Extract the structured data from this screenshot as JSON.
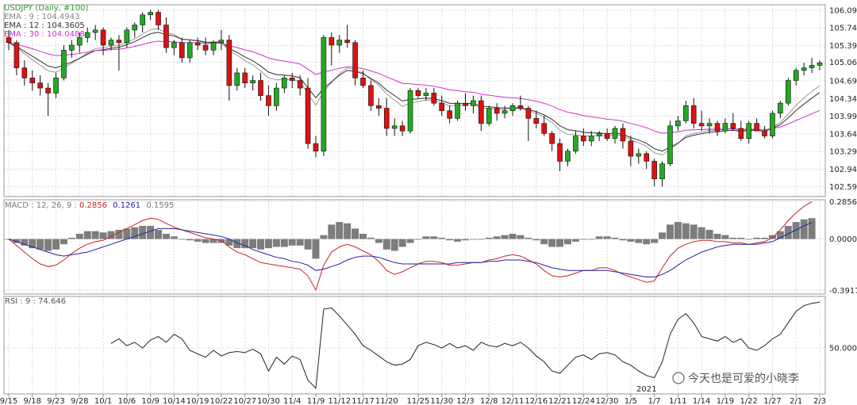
{
  "chart_data": [
    {
      "type": "candlestick",
      "title": "USDJPY (Daily, #100)",
      "ylim": [
        102.4,
        106.2
      ],
      "y_ticks": [
        "106.093",
        "105.743",
        "105.393",
        "105.065",
        "104.693",
        "104.343",
        "103.993",
        "103.643",
        "103.293",
        "102.943",
        "102.593"
      ],
      "ema_labels": [
        {
          "text": "EMA : 9 : 104.4943",
          "color": "#888888"
        },
        {
          "text": "EMA : 12 : 104.3605",
          "color": "#333333"
        },
        {
          "text": "EMA : 30 : 104.0488",
          "color": "#cc33cc"
        }
      ],
      "x_labels": [
        "9/15",
        "9/18",
        "9/23",
        "9/28",
        "10/1",
        "10/6",
        "10/9",
        "10/14",
        "10/19",
        "10/22",
        "10/27",
        "10/30",
        "11/4",
        "11/9",
        "11/12",
        "11/17",
        "11/20",
        "11/25",
        "11/30",
        "12/3",
        "12/8",
        "12/11",
        "12/16",
        "12/21",
        "12/24",
        "12/30",
        "1/5",
        "1/7",
        "1/11",
        "1/14",
        "1/19",
        "1/22",
        "1/27",
        "2/1",
        "2/3"
      ],
      "year_label": "2021",
      "up_color": "#22aa22",
      "down_color": "#dd1111",
      "candles": [
        [
          105.55,
          105.7,
          105.3,
          105.45
        ],
        [
          105.45,
          105.5,
          104.8,
          104.95
        ],
        [
          104.95,
          105.1,
          104.6,
          104.75
        ],
        [
          104.75,
          104.9,
          104.5,
          104.65
        ],
        [
          104.65,
          104.8,
          104.4,
          104.55
        ],
        [
          104.55,
          104.65,
          104.0,
          104.45
        ],
        [
          104.45,
          104.85,
          104.35,
          104.75
        ],
        [
          104.75,
          105.4,
          104.7,
          105.3
        ],
        [
          105.3,
          105.5,
          105.15,
          105.4
        ],
        [
          105.4,
          105.65,
          105.25,
          105.55
        ],
        [
          105.55,
          105.75,
          105.45,
          105.65
        ],
        [
          105.65,
          105.8,
          105.5,
          105.7
        ],
        [
          105.7,
          105.75,
          105.2,
          105.4
        ],
        [
          105.4,
          105.55,
          105.3,
          105.5
        ],
        [
          105.5,
          105.6,
          104.9,
          105.45
        ],
        [
          105.45,
          105.75,
          105.35,
          105.7
        ],
        [
          105.7,
          105.85,
          105.55,
          105.8
        ],
        [
          105.8,
          106.05,
          105.65,
          106.0
        ],
        [
          106.0,
          106.1,
          105.9,
          106.05
        ],
        [
          106.05,
          106.1,
          105.7,
          105.8
        ],
        [
          105.8,
          105.95,
          105.25,
          105.35
        ],
        [
          105.35,
          105.5,
          105.2,
          105.45
        ],
        [
          105.45,
          105.55,
          105.05,
          105.15
        ],
        [
          105.15,
          105.5,
          105.05,
          105.45
        ],
        [
          105.45,
          105.55,
          105.3,
          105.4
        ],
        [
          105.4,
          105.55,
          105.2,
          105.3
        ],
        [
          105.3,
          105.5,
          105.2,
          105.45
        ],
        [
          105.45,
          105.7,
          105.3,
          105.5
        ],
        [
          105.5,
          105.6,
          104.3,
          104.6
        ],
        [
          104.6,
          104.95,
          104.5,
          104.85
        ],
        [
          104.85,
          104.95,
          104.55,
          104.65
        ],
        [
          104.65,
          104.8,
          104.5,
          104.7
        ],
        [
          104.7,
          104.85,
          104.3,
          104.4
        ],
        [
          104.4,
          104.6,
          104.0,
          104.2
        ],
        [
          104.2,
          104.65,
          104.1,
          104.55
        ],
        [
          104.55,
          104.8,
          104.45,
          104.75
        ],
        [
          104.75,
          104.85,
          104.55,
          104.7
        ],
        [
          104.7,
          104.8,
          104.4,
          104.55
        ],
        [
          104.55,
          104.75,
          103.35,
          103.45
        ],
        [
          103.45,
          103.6,
          103.18,
          103.3
        ],
        [
          103.3,
          105.6,
          103.2,
          105.55
        ],
        [
          105.55,
          105.65,
          105.0,
          105.4
        ],
        [
          105.4,
          105.6,
          105.25,
          105.5
        ],
        [
          105.5,
          105.8,
          105.35,
          105.45
        ],
        [
          105.45,
          105.5,
          104.6,
          104.75
        ],
        [
          104.75,
          104.9,
          104.55,
          104.6
        ],
        [
          104.6,
          104.7,
          104.1,
          104.2
        ],
        [
          104.2,
          104.35,
          104.0,
          104.15
        ],
        [
          104.15,
          104.35,
          103.6,
          103.75
        ],
        [
          103.75,
          103.95,
          103.6,
          103.8
        ],
        [
          103.8,
          103.9,
          103.6,
          103.7
        ],
        [
          103.7,
          104.55,
          103.65,
          104.5
        ],
        [
          104.5,
          104.55,
          104.35,
          104.4
        ],
        [
          104.4,
          104.55,
          104.3,
          104.45
        ],
        [
          104.45,
          104.55,
          104.2,
          104.25
        ],
        [
          104.25,
          104.4,
          104.0,
          104.1
        ],
        [
          104.1,
          104.2,
          103.85,
          103.95
        ],
        [
          103.95,
          104.3,
          103.9,
          104.25
        ],
        [
          104.25,
          104.45,
          104.1,
          104.2
        ],
        [
          104.2,
          104.4,
          104.05,
          104.3
        ],
        [
          104.3,
          104.4,
          103.7,
          103.85
        ],
        [
          103.85,
          104.2,
          103.8,
          104.15
        ],
        [
          104.15,
          104.25,
          103.9,
          104.05
        ],
        [
          104.05,
          104.2,
          103.95,
          104.1
        ],
        [
          104.1,
          104.25,
          104.0,
          104.2
        ],
        [
          104.2,
          104.4,
          104.1,
          104.15
        ],
        [
          104.15,
          104.2,
          103.5,
          103.95
        ],
        [
          103.95,
          104.1,
          103.75,
          103.85
        ],
        [
          103.85,
          104.0,
          103.6,
          103.65
        ],
        [
          103.65,
          103.7,
          103.3,
          103.45
        ],
        [
          103.45,
          103.55,
          102.9,
          103.1
        ],
        [
          103.1,
          103.35,
          103.0,
          103.3
        ],
        [
          103.3,
          103.7,
          103.25,
          103.6
        ],
        [
          103.6,
          103.75,
          103.4,
          103.5
        ],
        [
          103.5,
          103.7,
          103.4,
          103.6
        ],
        [
          103.6,
          103.7,
          103.5,
          103.65
        ],
        [
          103.65,
          103.75,
          103.5,
          103.55
        ],
        [
          103.55,
          103.8,
          103.45,
          103.75
        ],
        [
          103.75,
          103.85,
          103.35,
          103.5
        ],
        [
          103.5,
          103.6,
          103.0,
          103.2
        ],
        [
          103.2,
          103.35,
          103.05,
          103.25
        ],
        [
          103.25,
          103.3,
          102.95,
          103.1
        ],
        [
          103.1,
          103.15,
          102.6,
          102.75
        ],
        [
          102.75,
          103.1,
          102.6,
          103.05
        ],
        [
          103.05,
          103.9,
          103.0,
          103.8
        ],
        [
          103.8,
          104.0,
          103.7,
          103.9
        ],
        [
          103.9,
          104.3,
          103.85,
          104.2
        ],
        [
          104.2,
          104.35,
          103.75,
          103.85
        ],
        [
          103.85,
          104.1,
          103.7,
          103.8
        ],
        [
          103.8,
          103.95,
          103.65,
          103.85
        ],
        [
          103.85,
          103.9,
          103.6,
          103.7
        ],
        [
          103.7,
          103.95,
          103.65,
          103.85
        ],
        [
          103.85,
          104.05,
          103.7,
          103.75
        ],
        [
          103.75,
          103.9,
          103.5,
          103.55
        ],
        [
          103.55,
          103.9,
          103.45,
          103.85
        ],
        [
          103.85,
          103.95,
          103.7,
          103.7
        ],
        [
          103.7,
          103.8,
          103.55,
          103.6
        ],
        [
          103.6,
          104.1,
          103.55,
          104.05
        ],
        [
          104.05,
          104.3,
          103.95,
          104.25
        ],
        [
          104.25,
          104.75,
          104.2,
          104.7
        ],
        [
          104.7,
          104.95,
          104.6,
          104.9
        ],
        [
          104.9,
          105.05,
          104.8,
          104.95
        ],
        [
          104.95,
          105.15,
          104.85,
          105.0
        ],
        [
          105.0,
          105.1,
          104.9,
          105.05
        ]
      ]
    },
    {
      "type": "line",
      "title": "MACD",
      "label_prefix": "MACD : 12, 26, 9 : ",
      "values_text": [
        "0.2856",
        "0.1261",
        "0.1595"
      ],
      "value_colors": [
        "#cc2222",
        "#2222aa",
        "#777777"
      ],
      "y_ticks": [
        "0.2856",
        "0.0000",
        "-0.3917"
      ],
      "ylim": [
        -0.42,
        0.3
      ],
      "series": [
        {
          "values": [
            -0.0,
            -0.05,
            -0.1,
            -0.15,
            -0.19,
            -0.21,
            -0.2,
            -0.16,
            -0.11,
            -0.07,
            -0.04,
            -0.02,
            -0.01,
            0.02,
            0.05,
            0.08,
            0.11,
            0.14,
            0.16,
            0.15,
            0.12,
            0.09,
            0.07,
            0.05,
            0.03,
            0.01,
            0.0,
            -0.01,
            -0.06,
            -0.1,
            -0.12,
            -0.15,
            -0.18,
            -0.19,
            -0.2,
            -0.21,
            -0.22,
            -0.23,
            -0.28,
            -0.39,
            -0.2,
            -0.1,
            -0.06,
            -0.04,
            -0.06,
            -0.09,
            -0.12,
            -0.17,
            -0.24,
            -0.27,
            -0.25,
            -0.22,
            -0.19,
            -0.17,
            -0.17,
            -0.18,
            -0.2,
            -0.2,
            -0.19,
            -0.18,
            -0.18,
            -0.16,
            -0.15,
            -0.13,
            -0.12,
            -0.13,
            -0.16,
            -0.19,
            -0.24,
            -0.28,
            -0.29,
            -0.28,
            -0.26,
            -0.24,
            -0.24,
            -0.22,
            -0.22,
            -0.24,
            -0.27,
            -0.29,
            -0.31,
            -0.33,
            -0.32,
            -0.22,
            -0.13,
            -0.07,
            -0.04,
            -0.02,
            -0.01,
            -0.01,
            -0.02,
            -0.02,
            -0.03,
            -0.03,
            -0.04,
            -0.03,
            -0.02,
            0.01,
            0.07,
            0.14,
            0.2,
            0.25,
            0.2856
          ]
        },
        {
          "values": [
            -0.0,
            -0.02,
            -0.04,
            -0.06,
            -0.08,
            -0.1,
            -0.12,
            -0.13,
            -0.12,
            -0.11,
            -0.1,
            -0.08,
            -0.06,
            -0.04,
            -0.02,
            0.0,
            0.02,
            0.04,
            0.06,
            0.08,
            0.08,
            0.08,
            0.07,
            0.06,
            0.05,
            0.04,
            0.03,
            0.02,
            -0.0,
            -0.03,
            -0.05,
            -0.08,
            -0.1,
            -0.12,
            -0.14,
            -0.15,
            -0.17,
            -0.18,
            -0.2,
            -0.24,
            -0.23,
            -0.21,
            -0.19,
            -0.16,
            -0.14,
            -0.13,
            -0.13,
            -0.14,
            -0.16,
            -0.18,
            -0.19,
            -0.19,
            -0.19,
            -0.19,
            -0.19,
            -0.19,
            -0.19,
            -0.18,
            -0.18,
            -0.18,
            -0.18,
            -0.17,
            -0.17,
            -0.16,
            -0.16,
            -0.16,
            -0.17,
            -0.18,
            -0.2,
            -0.22,
            -0.23,
            -0.24,
            -0.24,
            -0.24,
            -0.24,
            -0.24,
            -0.24,
            -0.25,
            -0.26,
            -0.27,
            -0.28,
            -0.29,
            -0.29,
            -0.27,
            -0.24,
            -0.2,
            -0.16,
            -0.13,
            -0.1,
            -0.08,
            -0.06,
            -0.05,
            -0.04,
            -0.04,
            -0.04,
            -0.04,
            -0.03,
            -0.02,
            0.01,
            0.04,
            0.07,
            0.1,
            0.1261
          ]
        },
        {
          "values": [
            0,
            -0.03,
            -0.05,
            -0.07,
            -0.08,
            -0.09,
            -0.08,
            -0.04,
            0.01,
            0.04,
            0.06,
            0.06,
            0.05,
            0.06,
            0.07,
            0.08,
            0.09,
            0.1,
            0.1,
            0.07,
            0.04,
            0.02,
            0.0,
            -0.01,
            -0.02,
            -0.03,
            -0.03,
            -0.03,
            -0.05,
            -0.07,
            -0.07,
            -0.07,
            -0.08,
            -0.07,
            -0.06,
            -0.06,
            -0.05,
            -0.05,
            -0.08,
            -0.15,
            0.03,
            0.11,
            0.13,
            0.12,
            0.08,
            0.04,
            0.01,
            -0.03,
            -0.08,
            -0.09,
            -0.06,
            -0.03,
            0.0,
            0.02,
            0.02,
            0.01,
            -0.01,
            -0.02,
            -0.01,
            -0.0,
            -0.0,
            0.01,
            0.02,
            0.03,
            0.04,
            0.03,
            0.01,
            -0.01,
            -0.04,
            -0.06,
            -0.06,
            -0.04,
            -0.02,
            -0.0,
            0.0,
            0.02,
            0.02,
            0.01,
            -0.01,
            -0.02,
            -0.03,
            -0.04,
            -0.03,
            0.05,
            0.11,
            0.13,
            0.12,
            0.11,
            0.09,
            0.07,
            0.04,
            0.03,
            0.01,
            0.01,
            0.0,
            0.01,
            0.01,
            0.03,
            0.06,
            0.1,
            0.13,
            0.15,
            0.1595
          ]
        }
      ]
    },
    {
      "type": "line",
      "title": "RSI",
      "label_text": "RSI : 9 : 74.646",
      "y_ticks": [
        "50.000"
      ],
      "ylim": [
        10,
        95
      ],
      "series": [
        {
          "values": [
            null,
            null,
            null,
            null,
            null,
            null,
            null,
            null,
            null,
            null,
            null,
            null,
            null,
            54,
            58,
            52,
            55,
            50,
            57,
            60,
            55,
            62,
            58,
            48,
            45,
            42,
            48,
            43,
            46,
            47,
            46,
            49,
            45,
            30,
            42,
            36,
            43,
            40,
            22,
            15,
            84,
            85,
            78,
            70,
            62,
            52,
            48,
            43,
            38,
            35,
            36,
            40,
            52,
            55,
            53,
            50,
            54,
            50,
            52,
            48,
            55,
            52,
            51,
            54,
            52,
            55,
            50,
            43,
            38,
            30,
            28,
            35,
            42,
            44,
            40,
            45,
            46,
            44,
            38,
            35,
            30,
            26,
            24,
            38,
            62,
            75,
            80,
            72,
            60,
            58,
            56,
            60,
            55,
            58,
            50,
            48,
            52,
            58,
            62,
            72,
            82,
            87,
            89,
            90
          ]
        }
      ]
    }
  ],
  "watermark": "今天也是可爱的小晓李"
}
